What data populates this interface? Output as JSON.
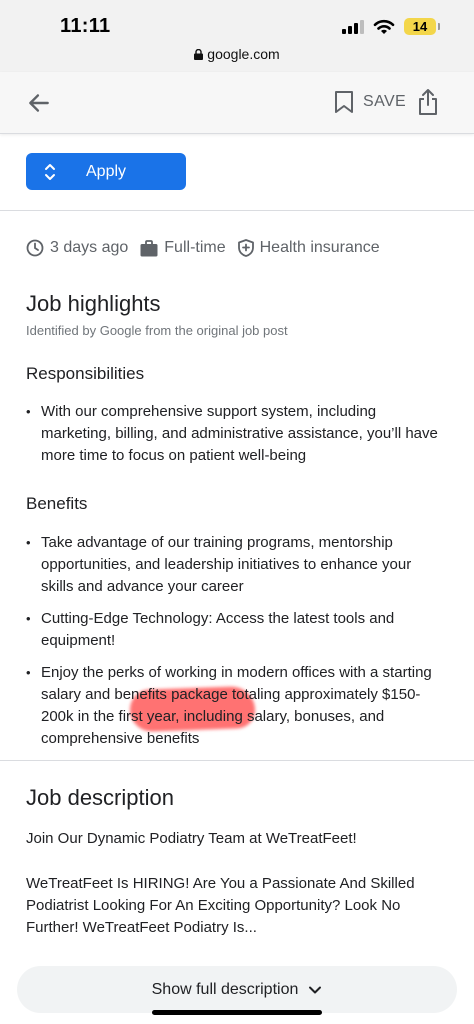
{
  "status": {
    "time": "11:11",
    "battery": "14",
    "url": "google.com"
  },
  "toolbar": {
    "save_label": "SAVE"
  },
  "apply": {
    "label": "Apply"
  },
  "meta": {
    "posted": "3 days ago",
    "type": "Full-time",
    "benefit": "Health insurance"
  },
  "highlights": {
    "title": "Job highlights",
    "subtitle": "Identified by Google from the original job post",
    "responsibilities_title": "Responsibilities",
    "responsibilities": [
      "With our comprehensive support system, including marketing, billing, and administrative assistance, you’ll have more time to focus on patient well-being"
    ],
    "benefits_title": "Benefits",
    "benefits": [
      "Take advantage of our training programs, mentorship opportunities, and leadership initiatives to enhance your skills and advance your career",
      "Cutting-Edge Technology: Access the latest tools and equipment!",
      "Enjoy the perks of working in modern offices with a starting salary and benefits package totaling approximately $150-200k in the first year, including salary, bonuses, and comprehensive benefits"
    ]
  },
  "description": {
    "title": "Job description",
    "para1": "Join Our Dynamic Podiatry Team at WeTreatFeet!",
    "para2": "WeTreatFeet Is HIRING! Are You a Passionate And Skilled Podiatrist Looking For An Exciting Opportunity? Look No Further! WeTreatFeet Podiatry Is...",
    "show_full_label": "Show full description"
  },
  "colors": {
    "accent": "#1a73e8",
    "highlight_mark": "#ff3c3c"
  }
}
